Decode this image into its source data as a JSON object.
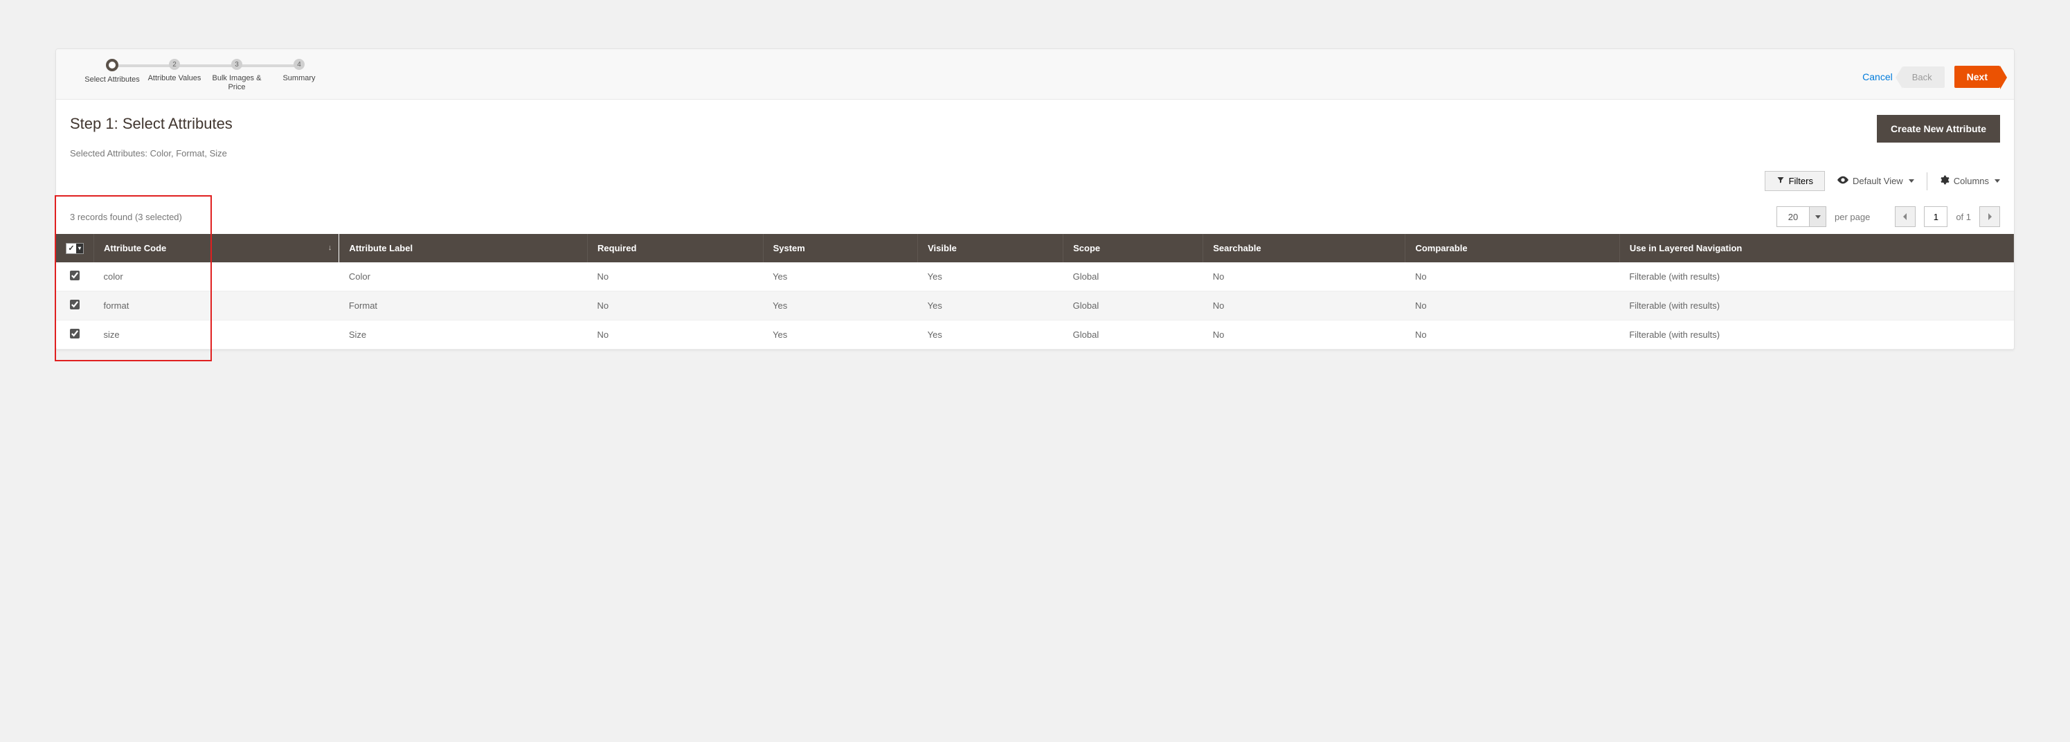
{
  "steps": [
    {
      "num": "",
      "label": "Select Attributes",
      "active": true
    },
    {
      "num": "2",
      "label": "Attribute Values",
      "active": false
    },
    {
      "num": "3",
      "label": "Bulk Images & Price",
      "active": false
    },
    {
      "num": "4",
      "label": "Summary",
      "active": false
    }
  ],
  "actions": {
    "cancel": "Cancel",
    "back": "Back",
    "next": "Next",
    "create_new": "Create New Attribute"
  },
  "step_title": "Step 1: Select Attributes",
  "selected_text": "Selected Attributes: Color, Format, Size",
  "toolbar": {
    "filters": "Filters",
    "default_view": "Default View",
    "columns": "Columns"
  },
  "records_found": "3 records found (3 selected)",
  "pagination": {
    "page_size": "20",
    "per_page": "per page",
    "current": "1",
    "of_label": "of 1"
  },
  "columns": {
    "attr_code": "Attribute Code",
    "attr_label": "Attribute Label",
    "required": "Required",
    "system": "System",
    "visible": "Visible",
    "scope": "Scope",
    "searchable": "Searchable",
    "comparable": "Comparable",
    "layered": "Use in Layered Navigation"
  },
  "rows": [
    {
      "checked": true,
      "code": "color",
      "label": "Color",
      "required": "No",
      "system": "Yes",
      "visible": "Yes",
      "scope": "Global",
      "searchable": "No",
      "comparable": "No",
      "layered": "Filterable (with results)"
    },
    {
      "checked": true,
      "code": "format",
      "label": "Format",
      "required": "No",
      "system": "Yes",
      "visible": "Yes",
      "scope": "Global",
      "searchable": "No",
      "comparable": "No",
      "layered": "Filterable (with results)"
    },
    {
      "checked": true,
      "code": "size",
      "label": "Size",
      "required": "No",
      "system": "Yes",
      "visible": "Yes",
      "scope": "Global",
      "searchable": "No",
      "comparable": "No",
      "layered": "Filterable (with results)"
    }
  ]
}
